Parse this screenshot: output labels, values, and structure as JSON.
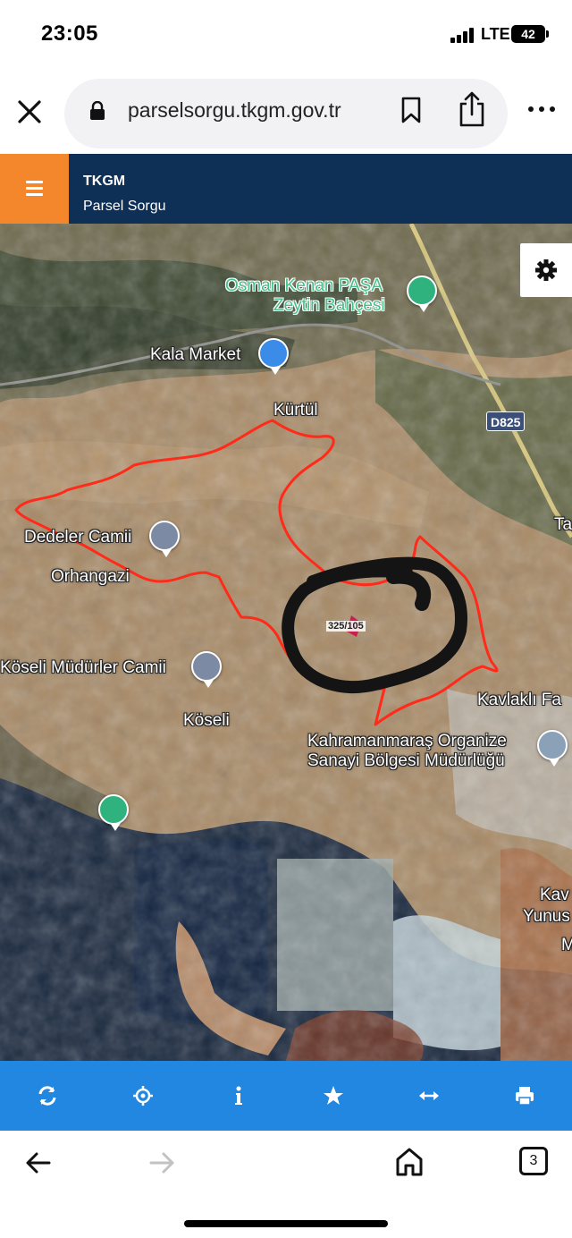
{
  "status": {
    "time": "23:05",
    "network": "LTE",
    "battery": "42"
  },
  "browser": {
    "url": "parselsorgu.tkgm.gov.tr",
    "tabs_count": "3"
  },
  "app": {
    "title": "TKGM",
    "subtitle": "Parsel Sorgu"
  },
  "map": {
    "labels": {
      "osmankenan_1": "Osman Kenan PAŞA",
      "osmankenan_2": "Zeytin Bahçesi",
      "kala_market": "Kala Market",
      "kurtul": "Kürtül",
      "road": "D825",
      "ta": "Ta",
      "dedeler_camii": "Dedeler Camii",
      "orhangazi": "Orhangazi",
      "koseli_camii": "Köseli Müdürler Camii",
      "koseli": "Köseli",
      "kavlakli": "Kavlaklı Fa",
      "osb_1": "Kahramanmaraş Organize",
      "osb_2": "Sanayi Bölgesi Müdürlüğü",
      "kav": "Kav",
      "yunus": "Yunus",
      "m": "M",
      "parcel": "325/105"
    }
  },
  "toolbar": {
    "buttons": [
      "refresh-icon",
      "locate-icon",
      "info-icon",
      "star-icon",
      "measure-icon",
      "print-icon"
    ]
  },
  "colors": {
    "header_bg": "#0e2f56",
    "menu_bg": "#f4862c",
    "toolbar_bg": "#2287e0",
    "parcel_outline": "#ff2a1a"
  }
}
